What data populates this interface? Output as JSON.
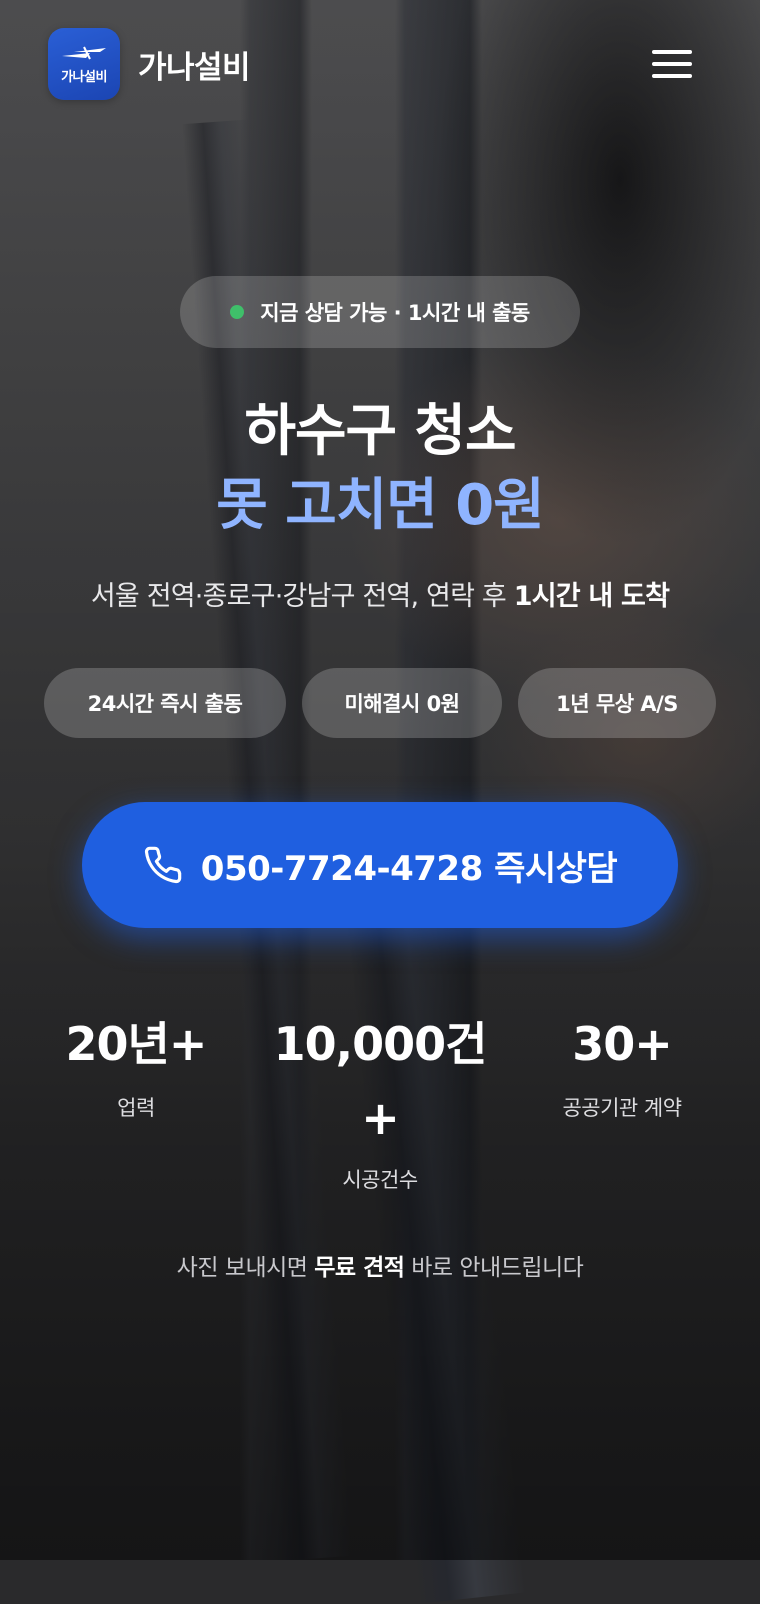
{
  "header": {
    "logo_text": "가나설비",
    "brand_name": "가나설비",
    "menu_icon": "hamburger-icon"
  },
  "status": {
    "text": "지금 상담 가능 · 1시간 내 출동",
    "dot_color": "#3fbf6a"
  },
  "hero": {
    "headline_line1": "하수구 청소",
    "headline_line2": "못 고치면 0원",
    "headline_accent_color": "#8fb4ff",
    "subline_prefix": "서울 전역·종로구·강남구 전역, 연락 후 ",
    "subline_emphasis": "1시간 내 도착"
  },
  "chips": [
    {
      "label": "24시간 즉시 출동"
    },
    {
      "label": "미해결시 0원"
    },
    {
      "label": "1년 무상 A/S"
    }
  ],
  "cta": {
    "label": "050-7724-4728 즉시상담",
    "icon": "phone-icon",
    "color": "#1f5fe0"
  },
  "stats": [
    {
      "value": "20년+",
      "label": "업력"
    },
    {
      "value": "10,000건",
      "value_suffix": "+",
      "label": "시공건수"
    },
    {
      "value": "30+",
      "label": "공공기관 계약"
    }
  ],
  "footnote": {
    "prefix": "사진 보내시면 ",
    "emphasis": "무료 견적",
    "suffix": " 바로 안내드립니다"
  }
}
